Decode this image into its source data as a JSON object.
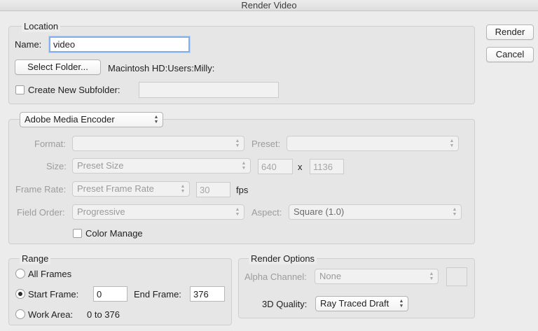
{
  "window": {
    "title": "Render Video"
  },
  "actions": {
    "render_label": "Render",
    "cancel_label": "Cancel"
  },
  "location": {
    "legend": "Location",
    "name_label": "Name:",
    "name_value": "video",
    "select_folder_label": "Select Folder...",
    "folder_path": "Macintosh HD:Users:Milly:",
    "create_subfolder_label": "Create New Subfolder:",
    "create_subfolder_checked": false,
    "subfolder_value": ""
  },
  "encoder": {
    "selected": "Adobe Media Encoder",
    "format_label": "Format:",
    "format_value": "",
    "preset_label": "Preset:",
    "preset_value": "",
    "size_label": "Size:",
    "size_value": "Preset Size",
    "width_value": "640",
    "x_label": "x",
    "height_value": "1136",
    "frame_rate_label": "Frame Rate:",
    "frame_rate_value": "Preset Frame Rate",
    "fps_value": "30",
    "fps_label": "fps",
    "field_order_label": "Field Order:",
    "field_order_value": "Progressive",
    "aspect_label": "Aspect:",
    "aspect_value": "Square (1.0)",
    "color_manage_label": "Color Manage",
    "color_manage_checked": false
  },
  "range": {
    "legend": "Range",
    "all_frames_label": "All Frames",
    "start_frame_label": "Start Frame:",
    "start_frame_value": "0",
    "end_frame_label": "End Frame:",
    "end_frame_value": "376",
    "work_area_label": "Work Area:",
    "work_area_value": "0 to 376",
    "selected_option": "Start Frame"
  },
  "render_options": {
    "legend": "Render Options",
    "alpha_channel_label": "Alpha Channel:",
    "alpha_channel_value": "None",
    "quality_label": "3D Quality:",
    "quality_value": "Ray Traced Draft"
  },
  "colors": {
    "focus_ring": "#7fb1f1",
    "window_bg": "#ececec"
  }
}
